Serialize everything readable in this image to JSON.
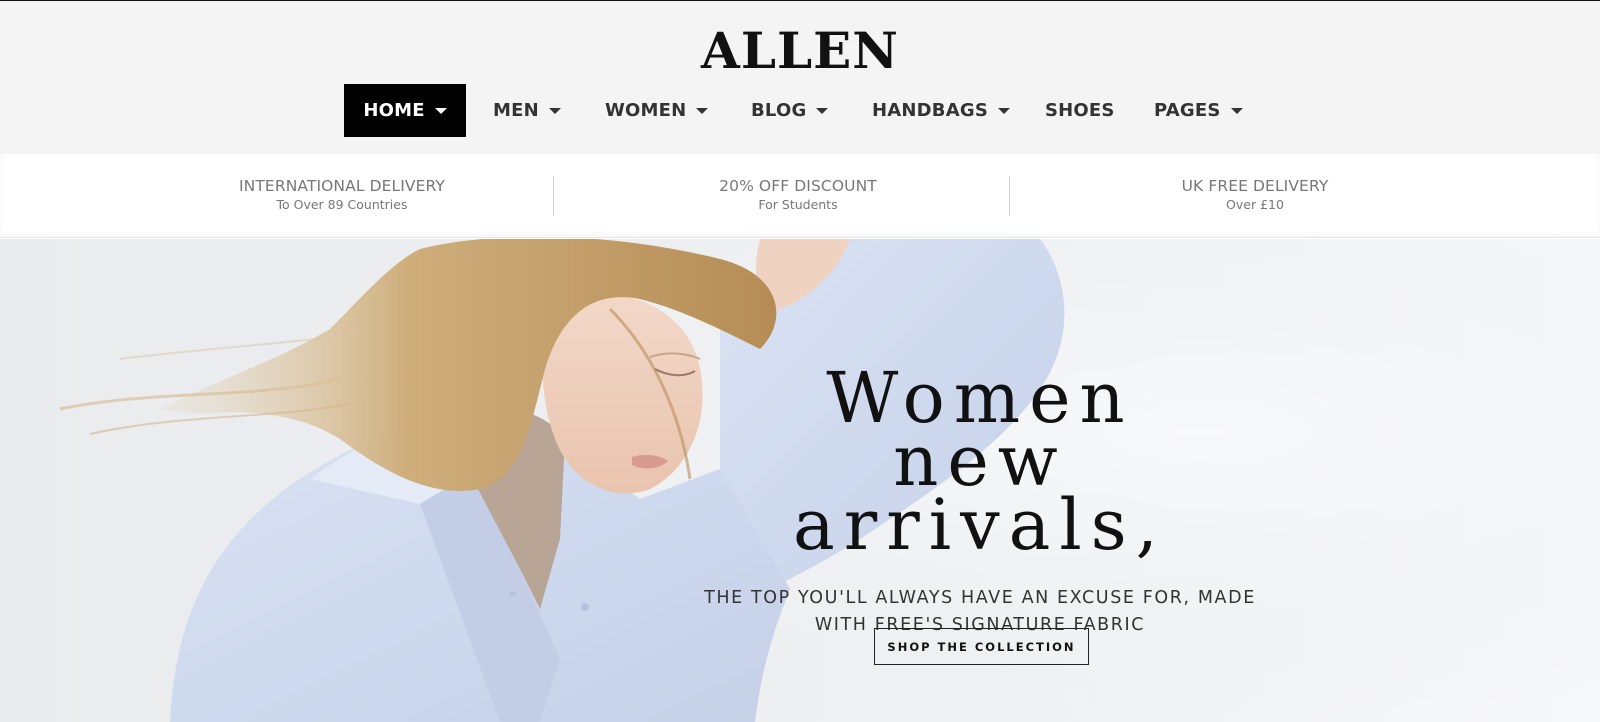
{
  "brand": {
    "logo_text": "ALLEN"
  },
  "nav": {
    "items": [
      {
        "label": "HOME",
        "has_dropdown": true,
        "active": true
      },
      {
        "label": "MEN",
        "has_dropdown": true,
        "active": false
      },
      {
        "label": "WOMEN",
        "has_dropdown": true,
        "active": false
      },
      {
        "label": "BLOG",
        "has_dropdown": true,
        "active": false
      },
      {
        "label": "HANDBAGS",
        "has_dropdown": true,
        "active": false
      },
      {
        "label": "SHOES",
        "has_dropdown": false,
        "active": false
      },
      {
        "label": "PAGES",
        "has_dropdown": true,
        "active": false
      }
    ]
  },
  "infobar": {
    "blocks": [
      {
        "title": "INTERNATIONAL DELIVERY",
        "subtitle": "To Over 89 Countries"
      },
      {
        "title": "20% OFF DISCOUNT",
        "subtitle": "For Students"
      },
      {
        "title": "UK FREE DELIVERY",
        "subtitle": "Over £10"
      }
    ]
  },
  "hero": {
    "title_line1": "Women",
    "title_line2": "new arrivals,",
    "subtitle_line1": "THE TOP YOU'LL ALWAYS HAVE AN EXCUSE FOR, MADE",
    "subtitle_line2": "WITH FREE'S SIGNATURE FABRIC",
    "cta_label": "SHOP THE COLLECTION"
  },
  "colors": {
    "header_bg": "#f4f4f4",
    "active_nav_bg": "#000000",
    "nav_text": "#333333",
    "info_text": "#777777",
    "hero_bg": "#eceef0",
    "shirt": "#cfdaf0",
    "hair": "#c9a46e"
  }
}
